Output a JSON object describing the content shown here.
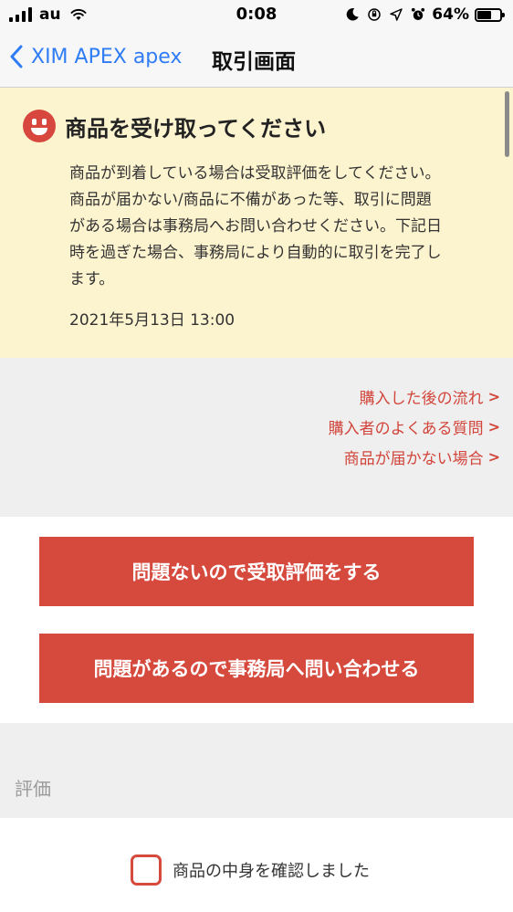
{
  "status_bar": {
    "carrier": "au",
    "time": "0:08",
    "battery_percent": "64%",
    "battery_level": 0.64,
    "icons": [
      "signal-icon",
      "wifi-icon",
      "moon-icon",
      "orientation-lock-icon",
      "location-icon",
      "alarm-icon",
      "battery-icon"
    ]
  },
  "nav": {
    "back_label": "XIM APEX apex",
    "title": "取引画面"
  },
  "notice": {
    "icon": "smiley-icon",
    "title": "商品を受け取ってください",
    "body_lines": [
      "商品が到着している場合は受取評価をしてください。",
      "商品が届かない/商品に不備があった等、取引に問題",
      "がある場合は事務局へお問い合わせください。下記日",
      "時を過ぎた場合、事務局により自動的に取引を完了し",
      "ます。"
    ],
    "date": "2021年5月13日 13:00"
  },
  "links": [
    {
      "label": "購入した後の流れ"
    },
    {
      "label": "購入者のよくある質問"
    },
    {
      "label": "商品が届かない場合"
    }
  ],
  "buttons": {
    "receive": "問題ないので受取評価をする",
    "contact": "問題があるので事務局へ問い合わせる"
  },
  "evaluation": {
    "heading": "評価",
    "confirm_label": "商品の中身を確認しました",
    "confirmed": false
  },
  "colors": {
    "accent_red": "#d64a3e",
    "link_red": "#d2453b",
    "ios_blue": "#2f7cf6",
    "notice_bg": "#fcf3cf"
  }
}
